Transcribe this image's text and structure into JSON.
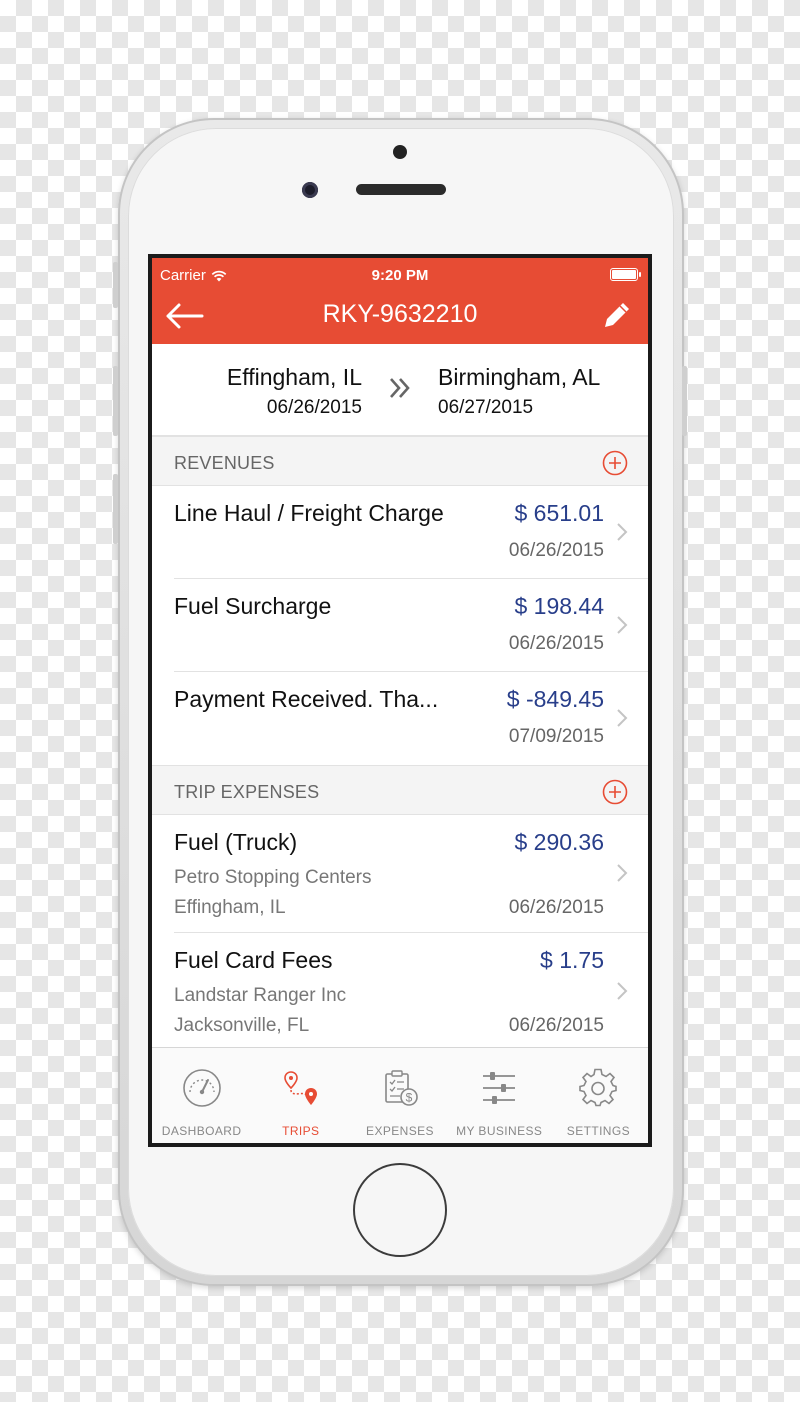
{
  "status_bar": {
    "carrier": "Carrier",
    "time": "9:20 PM"
  },
  "nav": {
    "title": "RKY-9632210",
    "back_icon": "back-arrow-icon",
    "edit_icon": "pencil-icon"
  },
  "route": {
    "origin": {
      "city": "Effingham, IL",
      "date": "06/26/2015"
    },
    "destination": {
      "city": "Birmingham, AL",
      "date": "06/27/2015"
    }
  },
  "revenues": {
    "header": "REVENUES",
    "items": [
      {
        "title": "Line Haul / Freight Charge",
        "amount": "$ 651.01",
        "date": "06/26/2015"
      },
      {
        "title": "Fuel Surcharge",
        "amount": "$ 198.44",
        "date": "06/26/2015"
      },
      {
        "title": "Payment Received. Tha...",
        "amount": "$ -849.45",
        "date": "07/09/2015"
      }
    ]
  },
  "expenses": {
    "header": "TRIP EXPENSES",
    "items": [
      {
        "title": "Fuel (Truck)",
        "vendor": "Petro Stopping Centers",
        "location": "Effingham, IL",
        "amount": "$ 290.36",
        "date": "06/26/2015"
      },
      {
        "title": "Fuel Card Fees",
        "vendor": "Landstar Ranger Inc",
        "location": "Jacksonville, FL",
        "amount": "$ 1.75",
        "date": "06/26/2015"
      }
    ]
  },
  "tabs": [
    {
      "label": "DASHBOARD",
      "icon": "speedometer-icon"
    },
    {
      "label": "TRIPS",
      "icon": "route-pin-icon",
      "active": true
    },
    {
      "label": "EXPENSES",
      "icon": "receipt-dollar-icon"
    },
    {
      "label": "MY BUSINESS",
      "icon": "sliders-icon"
    },
    {
      "label": "SETTINGS",
      "icon": "gear-icon"
    }
  ],
  "colors": {
    "accent": "#e74c34",
    "amount": "#283e8a",
    "muted": "#666666"
  }
}
